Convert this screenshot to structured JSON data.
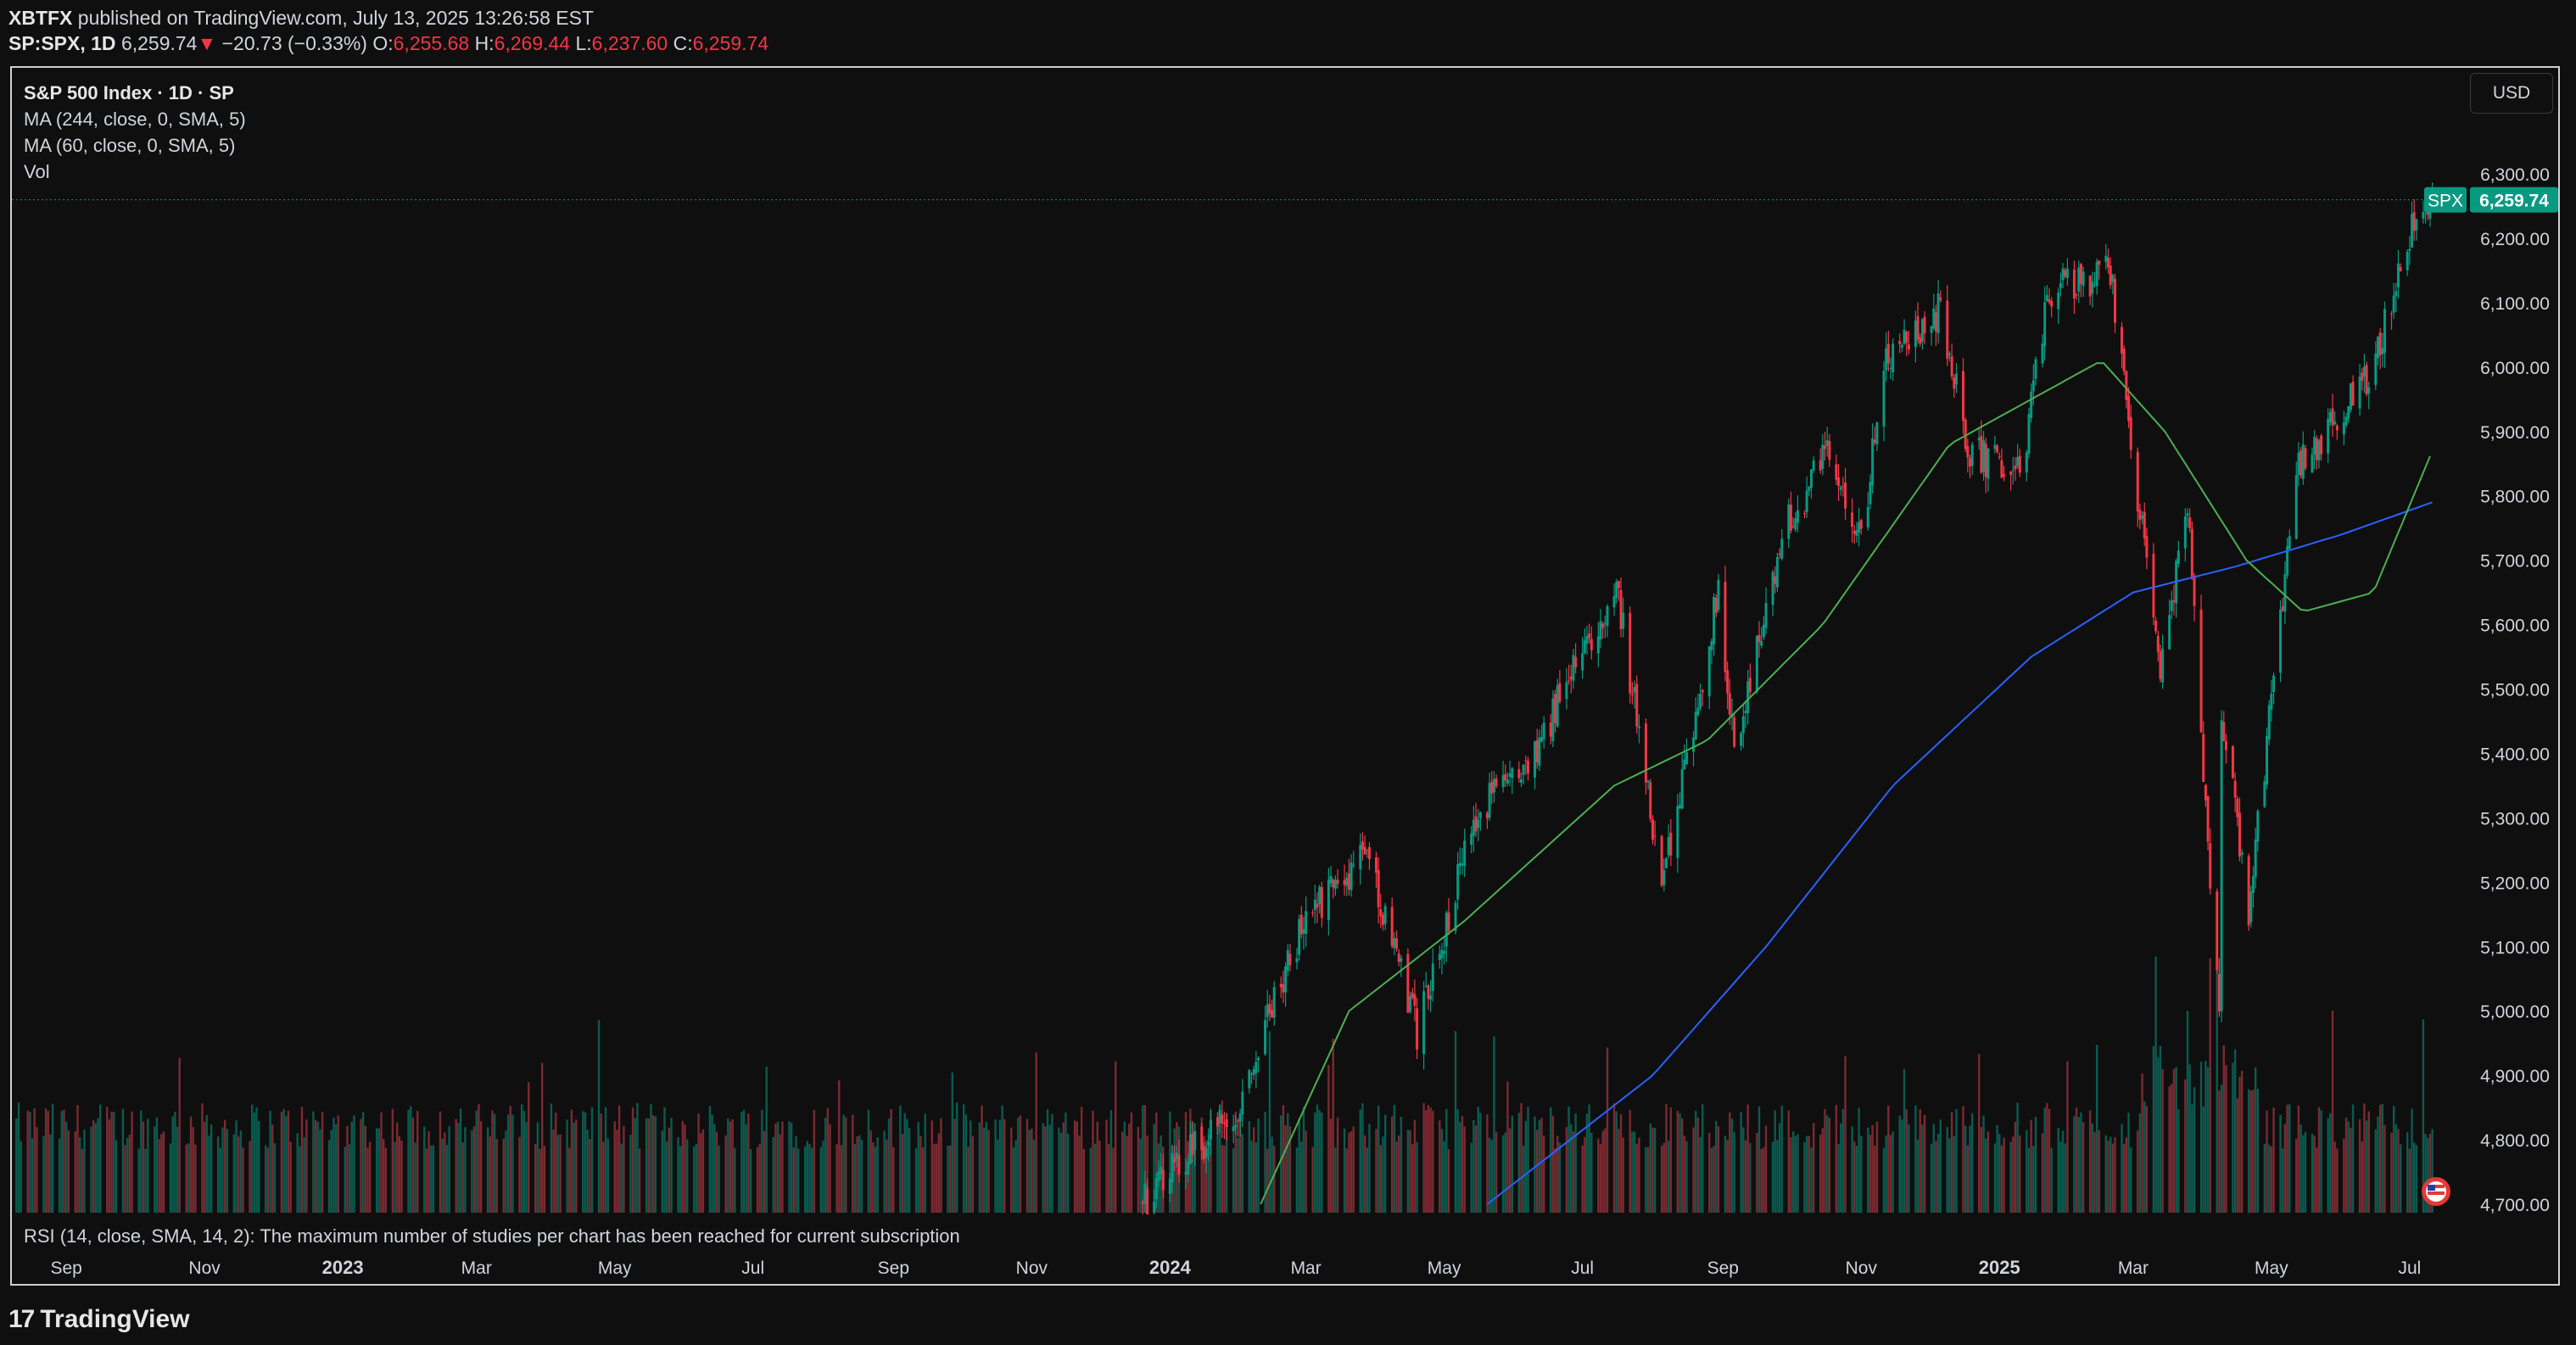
{
  "header": {
    "publisher": "XBTFX",
    "published_text": "published on TradingView.com, July 13, 2025 13:26:58 EST",
    "symbol_line": "SP:SPX, 1D",
    "last": "6,259.74",
    "change_arrow": "▼",
    "change": "−20.73 (−0.33%)",
    "o_label": "O:",
    "o": "6,255.68",
    "h_label": "H:",
    "h": "6,269.44",
    "l_label": "L:",
    "l": "6,237.60",
    "c_label": "C:",
    "c": "6,259.74"
  },
  "legend": {
    "title": "S&P 500 Index · 1D · SP",
    "ma1": "MA (244, close, 0, SMA, 5)",
    "ma2": "MA (60, close, 0, SMA, 5)",
    "vol": "Vol"
  },
  "currency_button": "USD",
  "price_tag": {
    "symbol": "SPX",
    "value": "6,259.74",
    "color": "#089981"
  },
  "rsi_notice": "RSI (14, close, SMA, 14, 2): The maximum number of studies per chart has been reached for current subscription",
  "brand": {
    "logo": "17",
    "name": "TradingView"
  },
  "colors": {
    "up": "#089981",
    "down": "#f23645",
    "ma244": "#2962ff",
    "ma60": "#4caf50"
  },
  "chart_data": {
    "type": "candlestick",
    "title": "S&P 500 Index · 1D · SP",
    "y_ticks": [
      "6,300.00",
      "6,200.00",
      "6,100.00",
      "6,000.00",
      "5,900.00",
      "5,800.00",
      "5,700.00",
      "5,600.00",
      "5,500.00",
      "5,400.00",
      "5,300.00",
      "5,200.00",
      "5,100.00",
      "5,000.00",
      "4,900.00",
      "4,800.00",
      "4,700.00"
    ],
    "y_tick_values": [
      6300,
      6200,
      6100,
      6000,
      5900,
      5800,
      5700,
      5600,
      5500,
      5400,
      5300,
      5200,
      5100,
      5000,
      4900,
      4800,
      4700
    ],
    "ylim": [
      4700,
      6300
    ],
    "x_ticks": [
      "Sep",
      "Nov",
      "2023",
      "Mar",
      "May",
      "Jul",
      "Sep",
      "Nov",
      "2024",
      "Mar",
      "May",
      "Jul",
      "Sep",
      "Nov",
      "2025",
      "Mar",
      "May",
      "Jul"
    ],
    "x_tick_dates": [
      "2022-09-01",
      "2022-11-01",
      "2023-01-01",
      "2023-03-01",
      "2023-05-01",
      "2023-07-01",
      "2023-09-01",
      "2023-11-01",
      "2024-01-01",
      "2024-03-01",
      "2024-05-01",
      "2024-07-01",
      "2024-09-01",
      "2024-11-01",
      "2025-01-01",
      "2025-03-01",
      "2025-05-01",
      "2025-07-01"
    ],
    "xlim": [
      "2022-08-08",
      "2025-07-25"
    ],
    "last_close": 6259.74,
    "close_path": [
      {
        "date": "2023-12-20",
        "close": 4700
      },
      {
        "date": "2024-01-10",
        "close": 4780
      },
      {
        "date": "2024-01-31",
        "close": 4850
      },
      {
        "date": "2024-02-15",
        "close": 5010
      },
      {
        "date": "2024-03-01",
        "close": 5140
      },
      {
        "date": "2024-03-28",
        "close": 5250
      },
      {
        "date": "2024-04-19",
        "close": 4970
      },
      {
        "date": "2024-05-15",
        "close": 5300
      },
      {
        "date": "2024-06-12",
        "close": 5420
      },
      {
        "date": "2024-07-16",
        "close": 5665
      },
      {
        "date": "2024-08-05",
        "close": 5190
      },
      {
        "date": "2024-08-30",
        "close": 5650
      },
      {
        "date": "2024-09-06",
        "close": 5410
      },
      {
        "date": "2024-09-30",
        "close": 5760
      },
      {
        "date": "2024-10-18",
        "close": 5870
      },
      {
        "date": "2024-11-01",
        "close": 5730
      },
      {
        "date": "2024-11-11",
        "close": 6000
      },
      {
        "date": "2024-12-06",
        "close": 6090
      },
      {
        "date": "2024-12-18",
        "close": 5870
      },
      {
        "date": "2025-01-10",
        "close": 5830
      },
      {
        "date": "2025-01-23",
        "close": 6120
      },
      {
        "date": "2025-02-19",
        "close": 6145
      },
      {
        "date": "2025-03-13",
        "close": 5520
      },
      {
        "date": "2025-03-25",
        "close": 5780
      },
      {
        "date": "2025-04-08",
        "close": 4980
      },
      {
        "date": "2025-04-09",
        "close": 5460
      },
      {
        "date": "2025-04-21",
        "close": 5160
      },
      {
        "date": "2025-05-12",
        "close": 5840
      },
      {
        "date": "2025-06-13",
        "close": 5980
      },
      {
        "date": "2025-06-30",
        "close": 6200
      },
      {
        "date": "2025-07-11",
        "close": 6259.74
      }
    ],
    "ma_244_path": [
      {
        "date": "2024-05-20",
        "value": 4700
      },
      {
        "date": "2024-08-01",
        "value": 4900
      },
      {
        "date": "2024-09-20",
        "value": 5100
      },
      {
        "date": "2024-11-15",
        "value": 5350
      },
      {
        "date": "2025-01-15",
        "value": 5550
      },
      {
        "date": "2025-03-01",
        "value": 5650
      },
      {
        "date": "2025-04-15",
        "value": 5690
      },
      {
        "date": "2025-06-01",
        "value": 5740
      },
      {
        "date": "2025-07-11",
        "value": 5790
      }
    ],
    "ma_60_path": [
      {
        "date": "2024-02-10",
        "value": 4700
      },
      {
        "date": "2024-03-20",
        "value": 5000
      },
      {
        "date": "2024-05-10",
        "value": 5140
      },
      {
        "date": "2024-07-15",
        "value": 5350
      },
      {
        "date": "2024-08-25",
        "value": 5420
      },
      {
        "date": "2024-10-15",
        "value": 5600
      },
      {
        "date": "2024-12-10",
        "value": 5880
      },
      {
        "date": "2025-02-15",
        "value": 6010
      },
      {
        "date": "2025-03-15",
        "value": 5900
      },
      {
        "date": "2025-04-20",
        "value": 5700
      },
      {
        "date": "2025-05-15",
        "value": 5620
      },
      {
        "date": "2025-06-15",
        "value": 5650
      },
      {
        "date": "2025-07-11",
        "value": 5870
      }
    ]
  }
}
